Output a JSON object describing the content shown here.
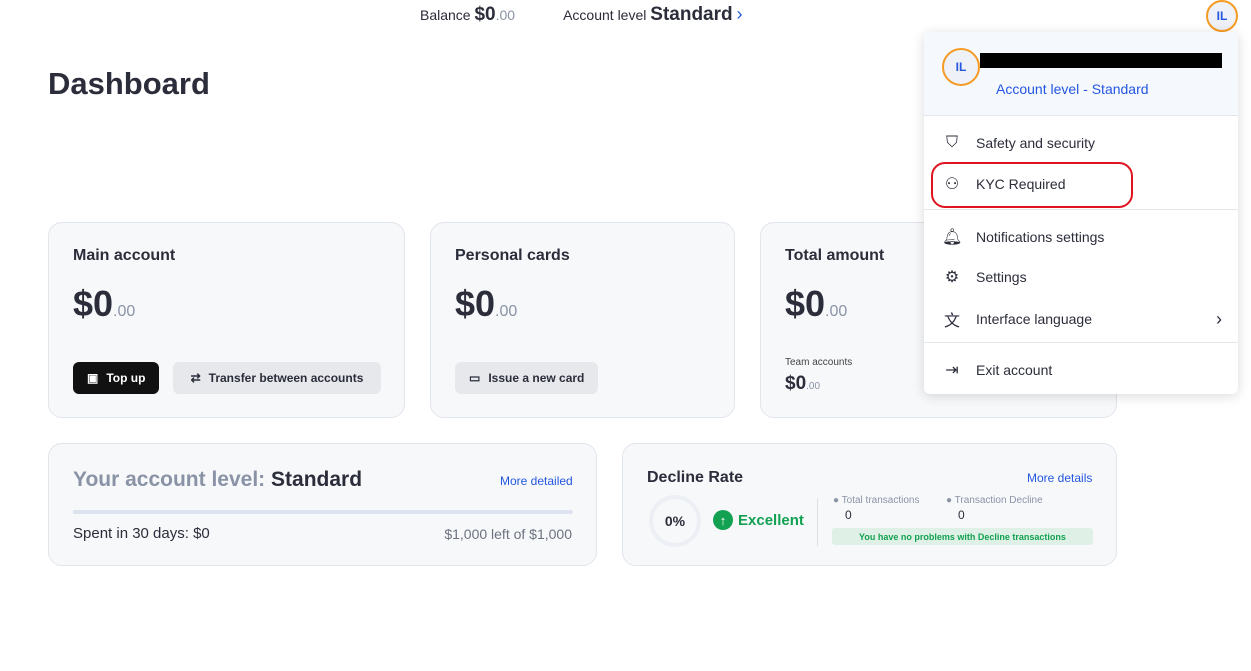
{
  "topbar": {
    "balance_label": "Balance",
    "balance_main": "$0",
    "balance_cents": ".00",
    "level_label": "Account level",
    "level_value": "Standard",
    "avatar": "IL"
  },
  "page_title": "Dashboard",
  "main_account": {
    "title": "Main account",
    "amount": "$0",
    "cents": ".00",
    "topup": "Top up",
    "transfer": "Transfer between accounts"
  },
  "personal_cards": {
    "title": "Personal cards",
    "amount": "$0",
    "cents": ".00",
    "issue": "Issue a new card"
  },
  "total_amount": {
    "title": "Total amount",
    "amount": "$0",
    "cents": ".00",
    "team_label": "Team accounts",
    "team_amount": "$0",
    "team_cents": ".00"
  },
  "level_card": {
    "label": "Your account level:",
    "value": "Standard",
    "link": "More detailed",
    "spent": "Spent in 30 days: $0",
    "left": "$1,000 left of $1,000",
    "progress_percent": 0
  },
  "decline": {
    "title": "Decline Rate",
    "link": "More details",
    "rate": "0%",
    "status": "Excellent",
    "total_label": "Total transactions",
    "total_value": "0",
    "decline_label": "Transaction Decline",
    "decline_value": "0",
    "message": "You have no problems with Decline transactions"
  },
  "menu": {
    "avatar": "IL",
    "account_level": "Account level - Standard",
    "items": [
      "Safety and security",
      "KYC Required",
      "Notifications settings",
      "Settings",
      "Interface language",
      "Exit account"
    ]
  },
  "colors": {
    "accent": "#2456e0",
    "success": "#12a150",
    "highlight": "#e0141e",
    "avatar_ring": "#f59a23"
  }
}
